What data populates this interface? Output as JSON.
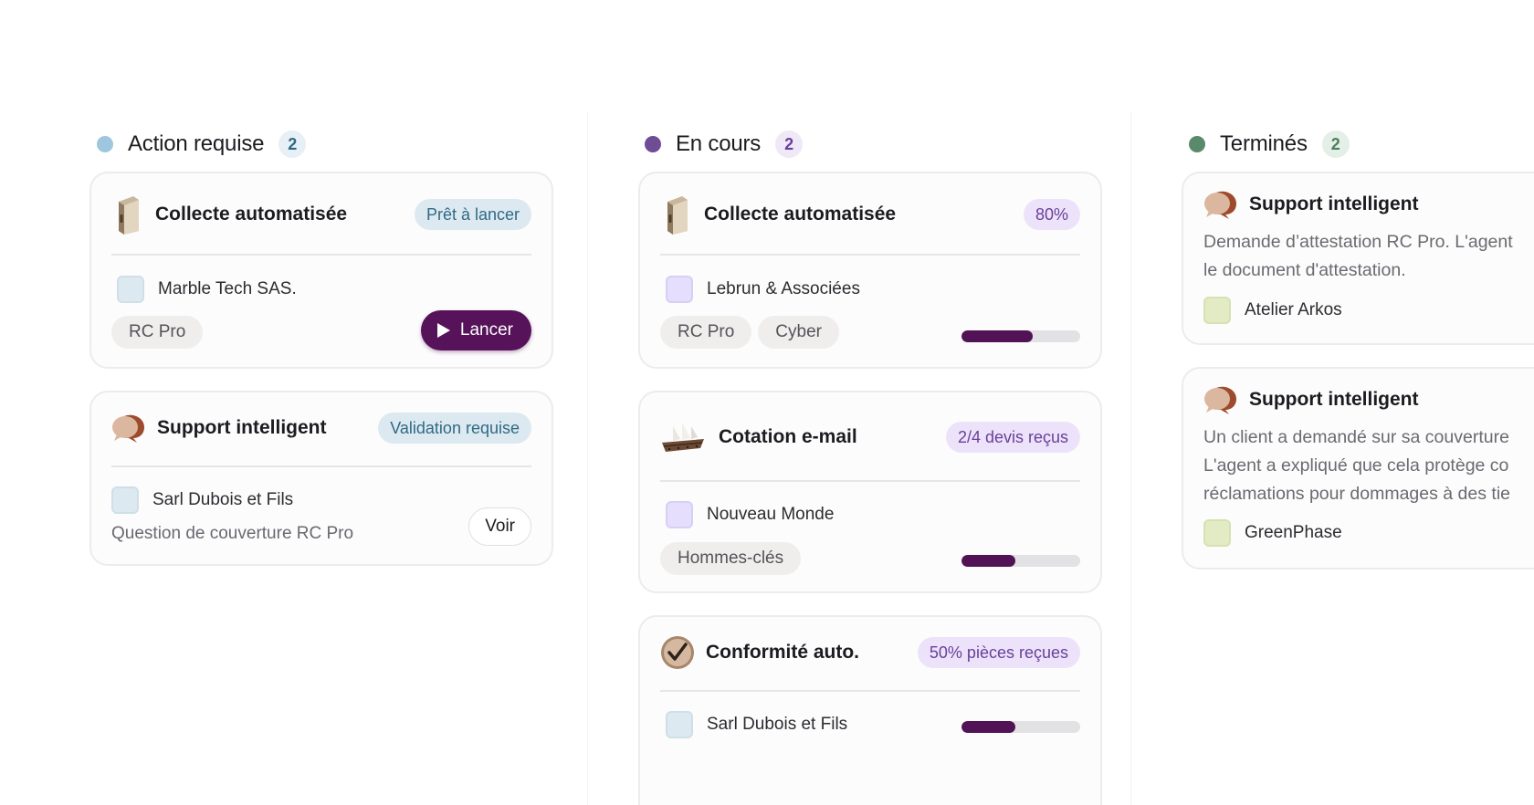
{
  "columns": [
    {
      "title": "Action requise",
      "count": "2",
      "dot_color": "#9ec7df",
      "cards": [
        {
          "title": "Collecte automatisée",
          "icon": "binder-icon",
          "status": "Prêt à lancer",
          "client": "Marble Tech SAS.",
          "tags": [
            "RC Pro"
          ],
          "action_label": "Lancer"
        },
        {
          "title": "Support intelligent",
          "icon": "chat-bubbles-icon",
          "status": "Validation requise",
          "client": "Sarl Dubois et Fils",
          "subtext": "Question de couverture RC Pro",
          "action_label": "Voir"
        }
      ]
    },
    {
      "title": "En cours",
      "count": "2",
      "dot_color": "#6e4c96",
      "cards": [
        {
          "title": "Collecte automatisée",
          "icon": "binder-icon",
          "status": "80%",
          "client": "Lebrun & Associées",
          "tags": [
            "RC Pro",
            "Cyber"
          ],
          "progress": 0.6
        },
        {
          "title": "Cotation e-mail",
          "icon": "sailboats-icon",
          "status": "2/4 devis reçus",
          "client": "Nouveau Monde",
          "tags": [
            "Hommes-clés"
          ],
          "progress": 0.45
        },
        {
          "title": "Conformité auto.",
          "icon": "checkmark-badge-icon",
          "status": "50% pièces reçues",
          "client": "Sarl Dubois et Fils",
          "progress": 0.45
        }
      ]
    },
    {
      "title": "Terminés",
      "count": "2",
      "dot_color": "#5b8a6b",
      "cards": [
        {
          "title": "Support intelligent",
          "icon": "chat-bubbles-icon",
          "description": [
            "Demande d’attestation RC Pro. L'agent",
            "le document d'attestation."
          ],
          "client": "Atelier Arkos"
        },
        {
          "title": "Support intelligent",
          "icon": "chat-bubbles-icon",
          "description": [
            "Un client a demandé sur sa couverture",
            "L'agent a expliqué que cela protège co",
            "réclamations pour dommages à des tie"
          ],
          "client": "GreenPhase"
        }
      ]
    }
  ],
  "colors": {
    "accent": "#561359",
    "progress_track": "#e2e1e3",
    "pill_blue_bg": "#dde9f0",
    "pill_blue_text": "#2f6a85",
    "pill_purple_bg": "#ece3fa",
    "pill_purple_text": "#6a3f9a",
    "client_blue": "#dde9f0",
    "client_purple": "#e5defc",
    "client_green": "#e3ebc4"
  }
}
